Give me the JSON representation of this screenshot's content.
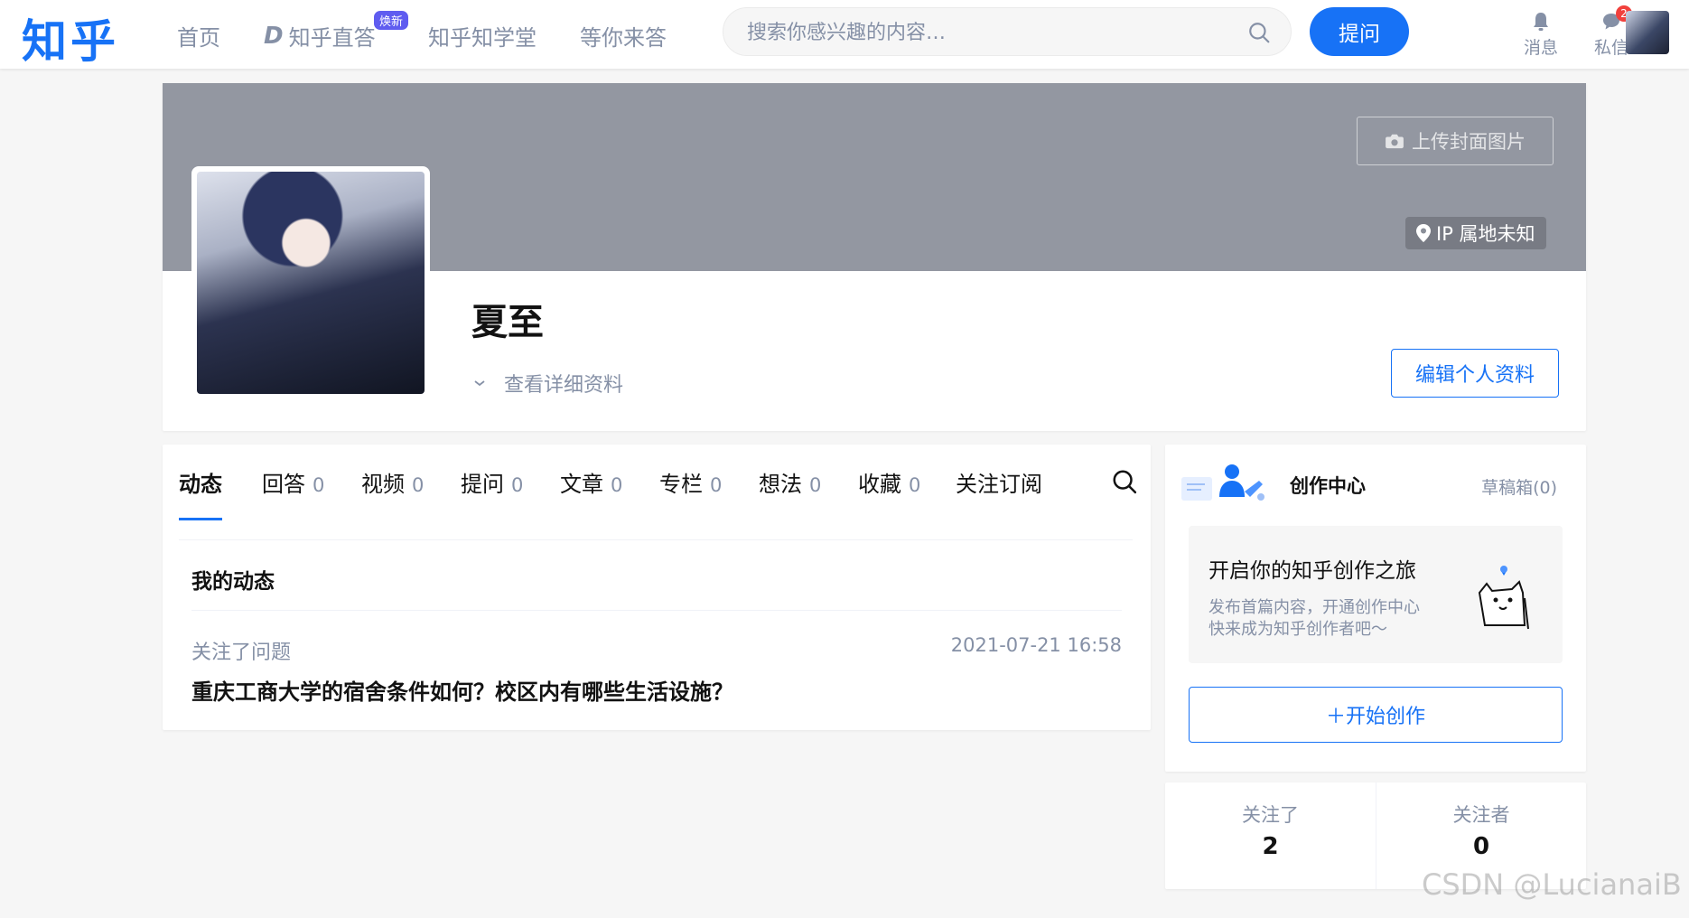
{
  "header": {
    "logo": "知乎",
    "nav": [
      "首页",
      "知乎直答",
      "知乎知学堂",
      "等你来答"
    ],
    "zhida_badge": "焕新",
    "search_placeholder": "搜索你感兴趣的内容…",
    "ask_label": "提问",
    "messages_label": "消息",
    "dm_label": "私信",
    "dm_count": "2"
  },
  "profile": {
    "upload_cover_label": "上传封面图片",
    "ip_location": "IP 属地未知",
    "username": "夏至",
    "view_detail_label": "查看详细资料",
    "edit_label": "编辑个人资料"
  },
  "tabs": [
    {
      "label": "动态",
      "count": ""
    },
    {
      "label": "回答",
      "count": "0"
    },
    {
      "label": "视频",
      "count": "0"
    },
    {
      "label": "提问",
      "count": "0"
    },
    {
      "label": "文章",
      "count": "0"
    },
    {
      "label": "专栏",
      "count": "0"
    },
    {
      "label": "想法",
      "count": "0"
    },
    {
      "label": "收藏",
      "count": "0"
    },
    {
      "label": "关注订阅",
      "count": ""
    }
  ],
  "feed": {
    "section_title": "我的动态",
    "action": "关注了问题",
    "time": "2021-07-21 16:58",
    "title": "重庆工商大学的宿舍条件如何？校区内有哪些生活设施？"
  },
  "creator": {
    "title": "创作中心",
    "draft": "草稿箱(0)",
    "box_title": "开启你的知乎创作之旅",
    "box_desc1": "发布首篇内容，开通创作中心",
    "box_desc2": "快来成为知乎创作者吧～",
    "start_label": "＋开始创作"
  },
  "follow": {
    "following_label": "关注了",
    "following_count": "2",
    "followers_label": "关注者",
    "followers_count": "0"
  },
  "watermark": "CSDN @LucianaiB",
  "colors": {
    "brand": "#1772f6",
    "cover": "#9397a1",
    "muted": "#8590a6"
  }
}
